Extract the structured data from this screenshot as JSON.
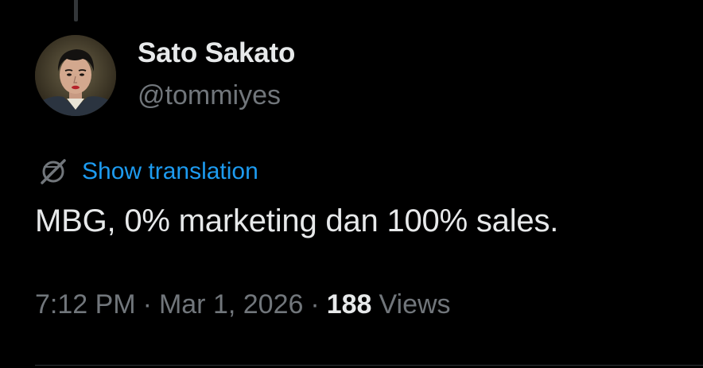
{
  "author": {
    "display_name": "Sato Sakato",
    "handle": "@tommiyes"
  },
  "translation": {
    "icon": "globe-slash-icon",
    "link_label": "Show translation"
  },
  "tweet": {
    "text": "MBG, 0% marketing dan 100% sales."
  },
  "meta": {
    "time": "7:12 PM",
    "separator": "·",
    "date": "Mar 1, 2026",
    "views_count": "188",
    "views_label": "Views"
  },
  "colors": {
    "background": "#000000",
    "primary_text": "#e7e9ea",
    "secondary_text": "#71767b",
    "link": "#1d9bf0",
    "divider": "#2f3336"
  }
}
